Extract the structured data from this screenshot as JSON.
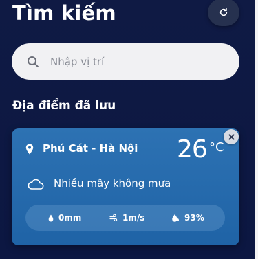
{
  "header": {
    "title": "Tìm kiếm",
    "refresh_icon": "refresh-icon"
  },
  "search": {
    "placeholder": "Nhập vị trí",
    "icon": "search-icon"
  },
  "saved_section": {
    "title": "Địa điểm đã lưu"
  },
  "saved_locations": [
    {
      "name": "Phú Cát - Hà Nội",
      "temperature": "26",
      "unit": "°C",
      "description": "Nhiều mây không mưa",
      "rain": "0mm",
      "wind": "1m/s",
      "humidity": "93%"
    }
  ],
  "colors": {
    "background": "#0f1a44",
    "card": "#2a6fb0",
    "search_bg": "#f1f1f3"
  }
}
